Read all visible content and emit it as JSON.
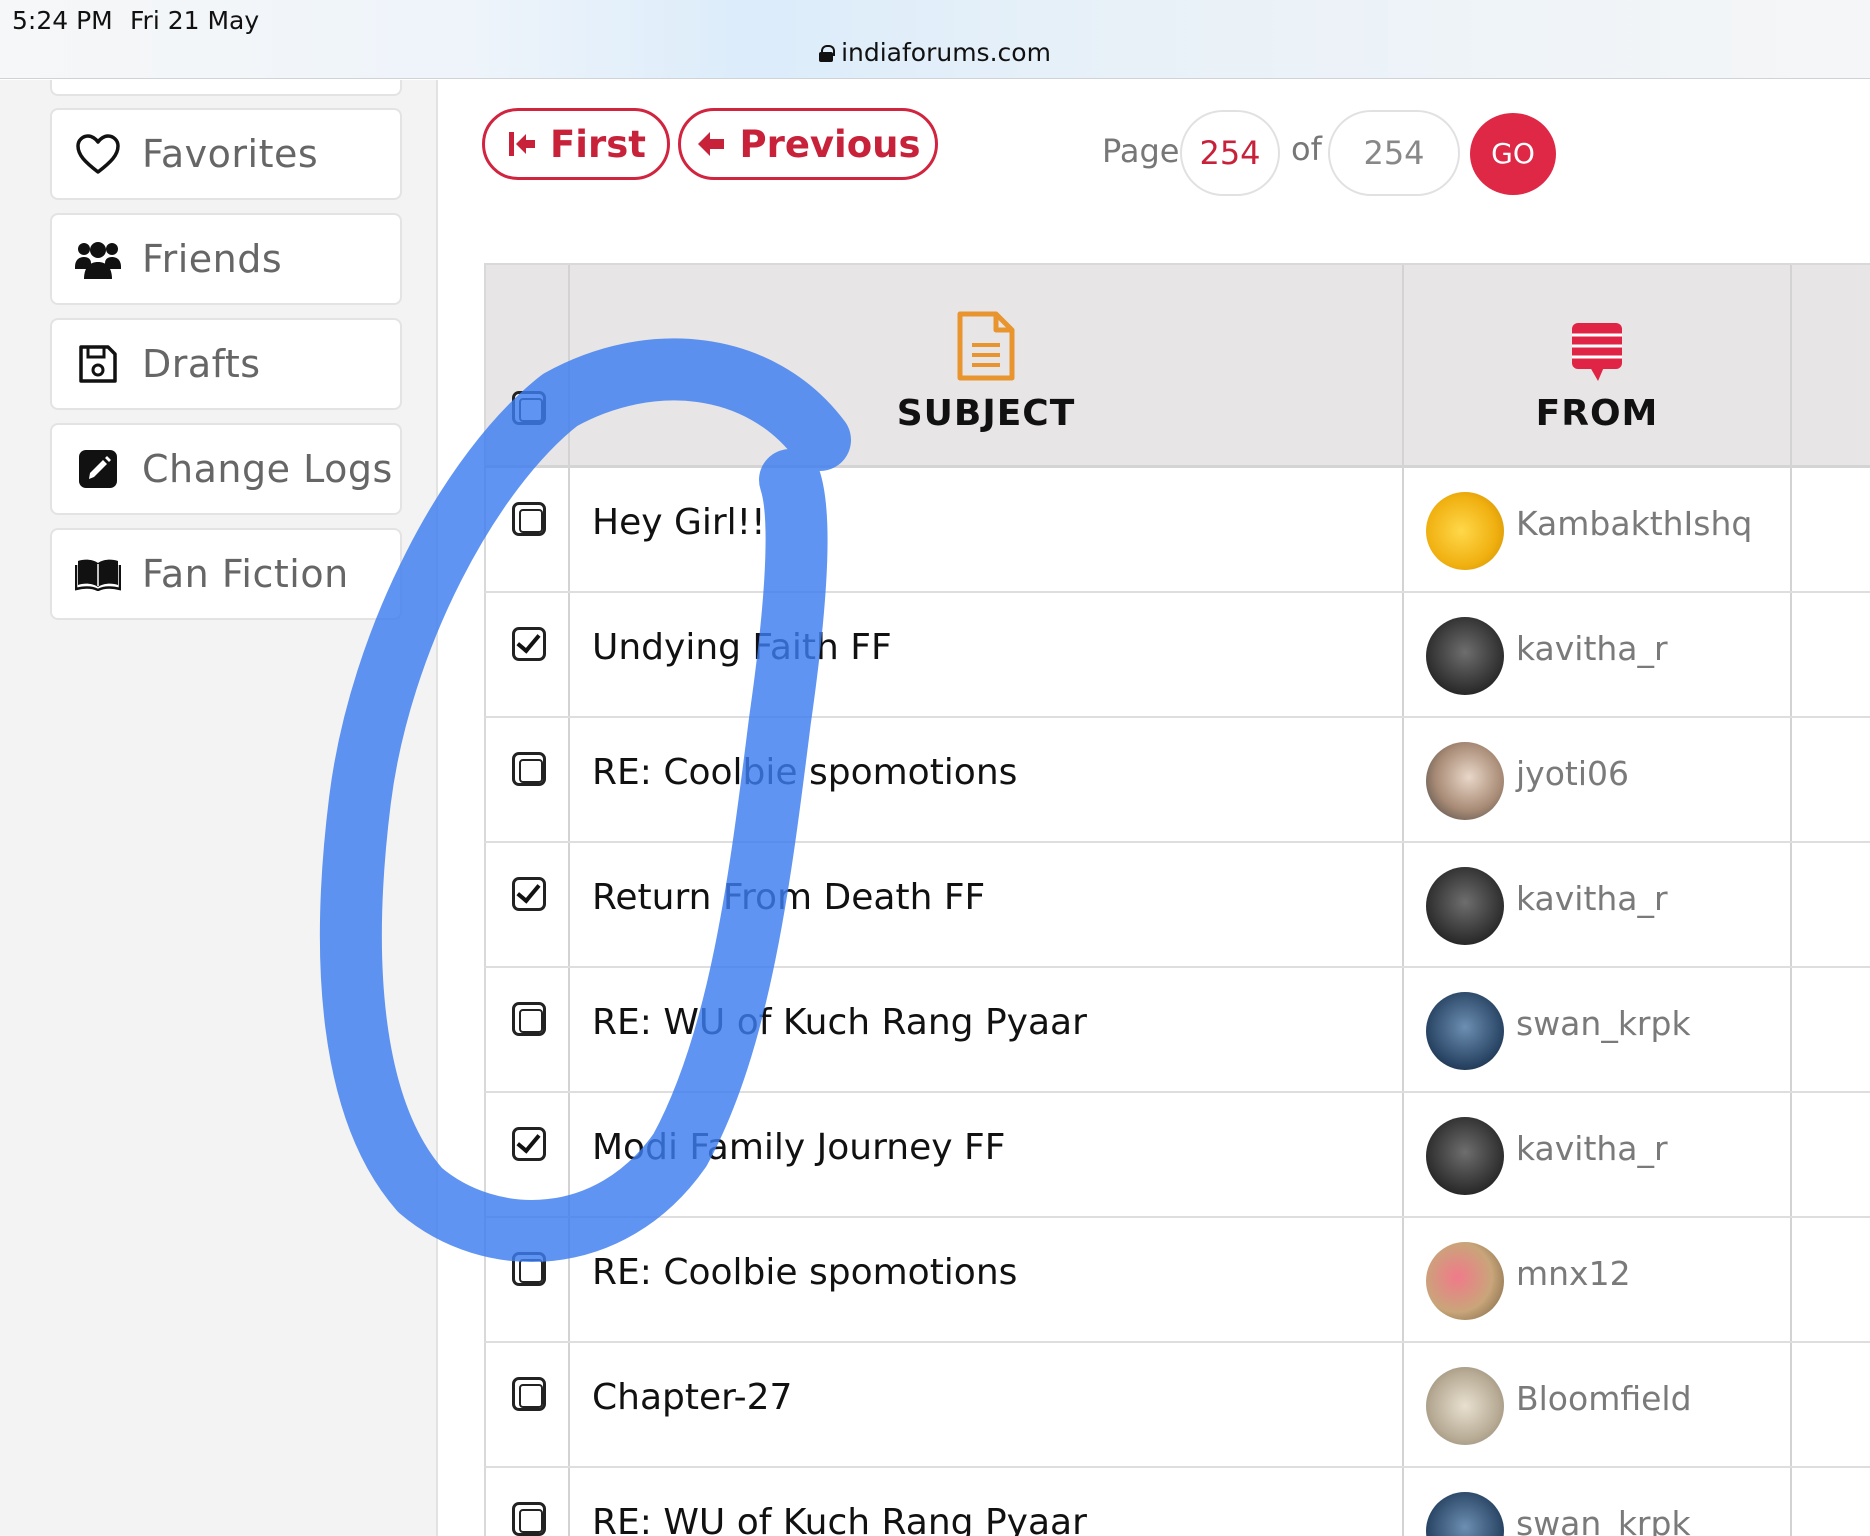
{
  "status": {
    "time": "5:24 PM",
    "date": "Fri 21 May",
    "url": "indiaforums.com"
  },
  "sidebar": {
    "items": [
      {
        "label": "Favorites",
        "icon": "heart-icon"
      },
      {
        "label": "Friends",
        "icon": "users-icon"
      },
      {
        "label": "Drafts",
        "icon": "floppy-disk-icon"
      },
      {
        "label": "Change Logs",
        "icon": "edit-icon"
      },
      {
        "label": "Fan Fiction",
        "icon": "open-book-icon"
      }
    ]
  },
  "pager": {
    "first_label": "First",
    "previous_label": "Previous",
    "page_label": "Page",
    "current_page": "254",
    "of_label": "of",
    "total_pages": "254",
    "go_label": "GO"
  },
  "table": {
    "headers": {
      "subject": "SUBJECT",
      "from": "FROM"
    },
    "rows": [
      {
        "subject": "Hey Girl!!",
        "from": "KambakthIshq",
        "checked": false
      },
      {
        "subject": "Undying Faith FF",
        "from": "kavitha_r",
        "checked": true
      },
      {
        "subject": "RE: Coolbie spomotions",
        "from": "jyoti06",
        "checked": false
      },
      {
        "subject": "Return From Death FF",
        "from": "kavitha_r",
        "checked": true
      },
      {
        "subject": "RE: WU of Kuch Rang Pyaar",
        "from": "swan_krpk",
        "checked": false
      },
      {
        "subject": "Modi Family Journey FF",
        "from": "kavitha_r",
        "checked": true
      },
      {
        "subject": "RE: Coolbie spomotions",
        "from": "mnx12",
        "checked": false
      },
      {
        "subject": "Chapter-27",
        "from": "Bloomfield",
        "checked": false
      },
      {
        "subject": "RE: WU of Kuch Rang Pyaar",
        "from": "swan_krpk",
        "checked": false
      }
    ]
  },
  "colors": {
    "accent": "#d0243f",
    "go_button": "#df2746",
    "subject_icon": "#e8952f",
    "from_icon": "#e02445",
    "annotation": "#3c7df0"
  }
}
